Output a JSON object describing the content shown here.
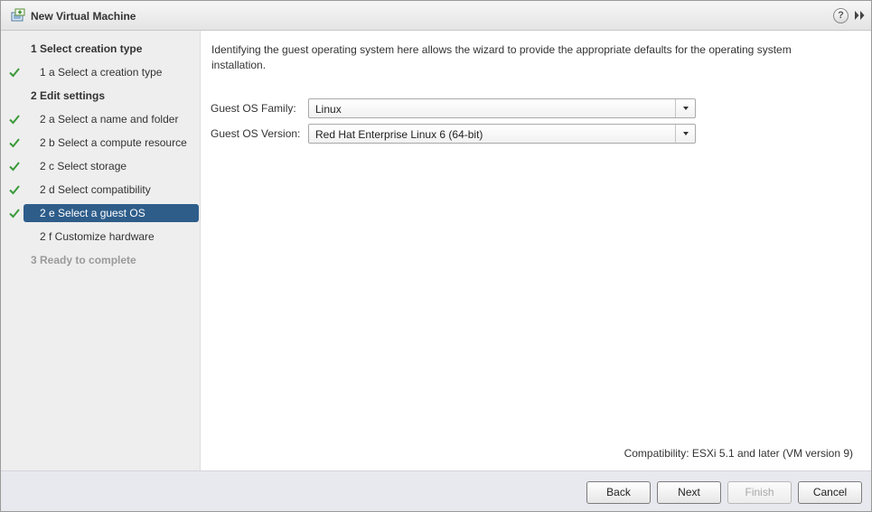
{
  "window": {
    "title": "New Virtual Machine",
    "title_icon": "new-vm-icon",
    "help_label": "?",
    "expand_icon": "double-chevron-right-icon"
  },
  "steps": [
    {
      "label": "1  Select creation type",
      "kind": "header",
      "completed": false
    },
    {
      "label": "1 a  Select a creation type",
      "kind": "sub",
      "completed": true
    },
    {
      "label": "2  Edit settings",
      "kind": "header",
      "completed": false
    },
    {
      "label": "2 a  Select a name and folder",
      "kind": "sub",
      "completed": true
    },
    {
      "label": "2 b  Select a compute resource",
      "kind": "sub",
      "completed": true
    },
    {
      "label": "2 c  Select storage",
      "kind": "sub",
      "completed": true
    },
    {
      "label": "2 d  Select compatibility",
      "kind": "sub",
      "completed": true
    },
    {
      "label": "2 e  Select a guest OS",
      "kind": "sub",
      "completed": true,
      "active": true
    },
    {
      "label": "2 f  Customize hardware",
      "kind": "sub",
      "completed": false
    },
    {
      "label": "3  Ready to complete",
      "kind": "header",
      "completed": false,
      "disabled": true
    }
  ],
  "content": {
    "intro": "Identifying the guest operating system here allows the wizard to provide the appropriate defaults for the operating system installation.",
    "guest_os_family": {
      "label": "Guest OS Family:",
      "value": "Linux"
    },
    "guest_os_version": {
      "label": "Guest OS Version:",
      "value": "Red Hat Enterprise Linux 6 (64-bit)"
    },
    "compatibility": "Compatibility: ESXi 5.1 and later (VM version 9)"
  },
  "footer": {
    "back": "Back",
    "next": "Next",
    "finish": "Finish",
    "cancel": "Cancel"
  },
  "colors": {
    "accent": "#2e5d8a",
    "check": "#3a9a3a"
  }
}
